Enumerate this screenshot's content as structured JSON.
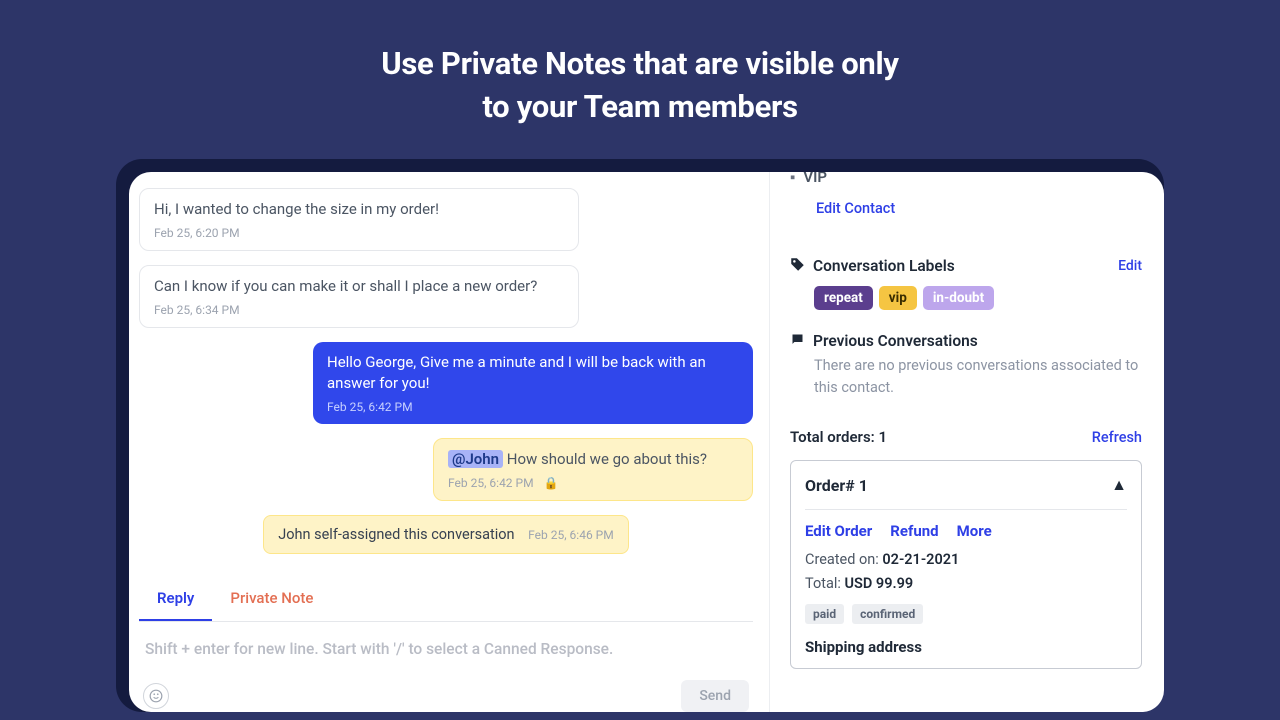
{
  "headline_l1": "Use Private Notes that are visible only",
  "headline_l2": "to your Team members",
  "messages": {
    "m1": {
      "text": "Hi, I wanted to change the size in my order!",
      "ts": "Feb 25, 6:20 PM"
    },
    "m2": {
      "text": "Can I know if you can make it or shall I place a new order?",
      "ts": "Feb 25, 6:34 PM"
    },
    "m3": {
      "text": "Hello George, Give me a minute and I will be back with an answer for you!",
      "ts": "Feb 25, 6:42 PM"
    },
    "m4": {
      "mention": "@John",
      "text": " How should we go about this?",
      "ts": "Feb 25, 6:42 PM"
    },
    "sys": {
      "text": "John self-assigned this conversation",
      "ts": "Feb 25, 6:46 PM"
    }
  },
  "composer": {
    "tab_reply": "Reply",
    "tab_note": "Private Note",
    "placeholder": "Shift + enter for new line. Start with '/' to select a Canned Response.",
    "send": "Send"
  },
  "sidebar": {
    "vip_tag": "VIP",
    "edit_contact": "Edit Contact",
    "labels_title": "Conversation Labels",
    "edit": "Edit",
    "labels": {
      "repeat": "repeat",
      "vip": "vip",
      "indoubt": "in-doubt"
    },
    "prev_title": "Previous Conversations",
    "prev_empty": "There are no previous conversations associated to this contact.",
    "total_orders_label": "Total orders: ",
    "total_orders": "1",
    "refresh": "Refresh",
    "order": {
      "title": "Order# 1",
      "edit": "Edit Order",
      "refund": "Refund",
      "more": "More",
      "created_label": "Created on: ",
      "created": "02-21-2021",
      "total_label": "Total: ",
      "total": "USD 99.99",
      "status_paid": "paid",
      "status_confirmed": "confirmed",
      "shipping_h": "Shipping address"
    }
  }
}
